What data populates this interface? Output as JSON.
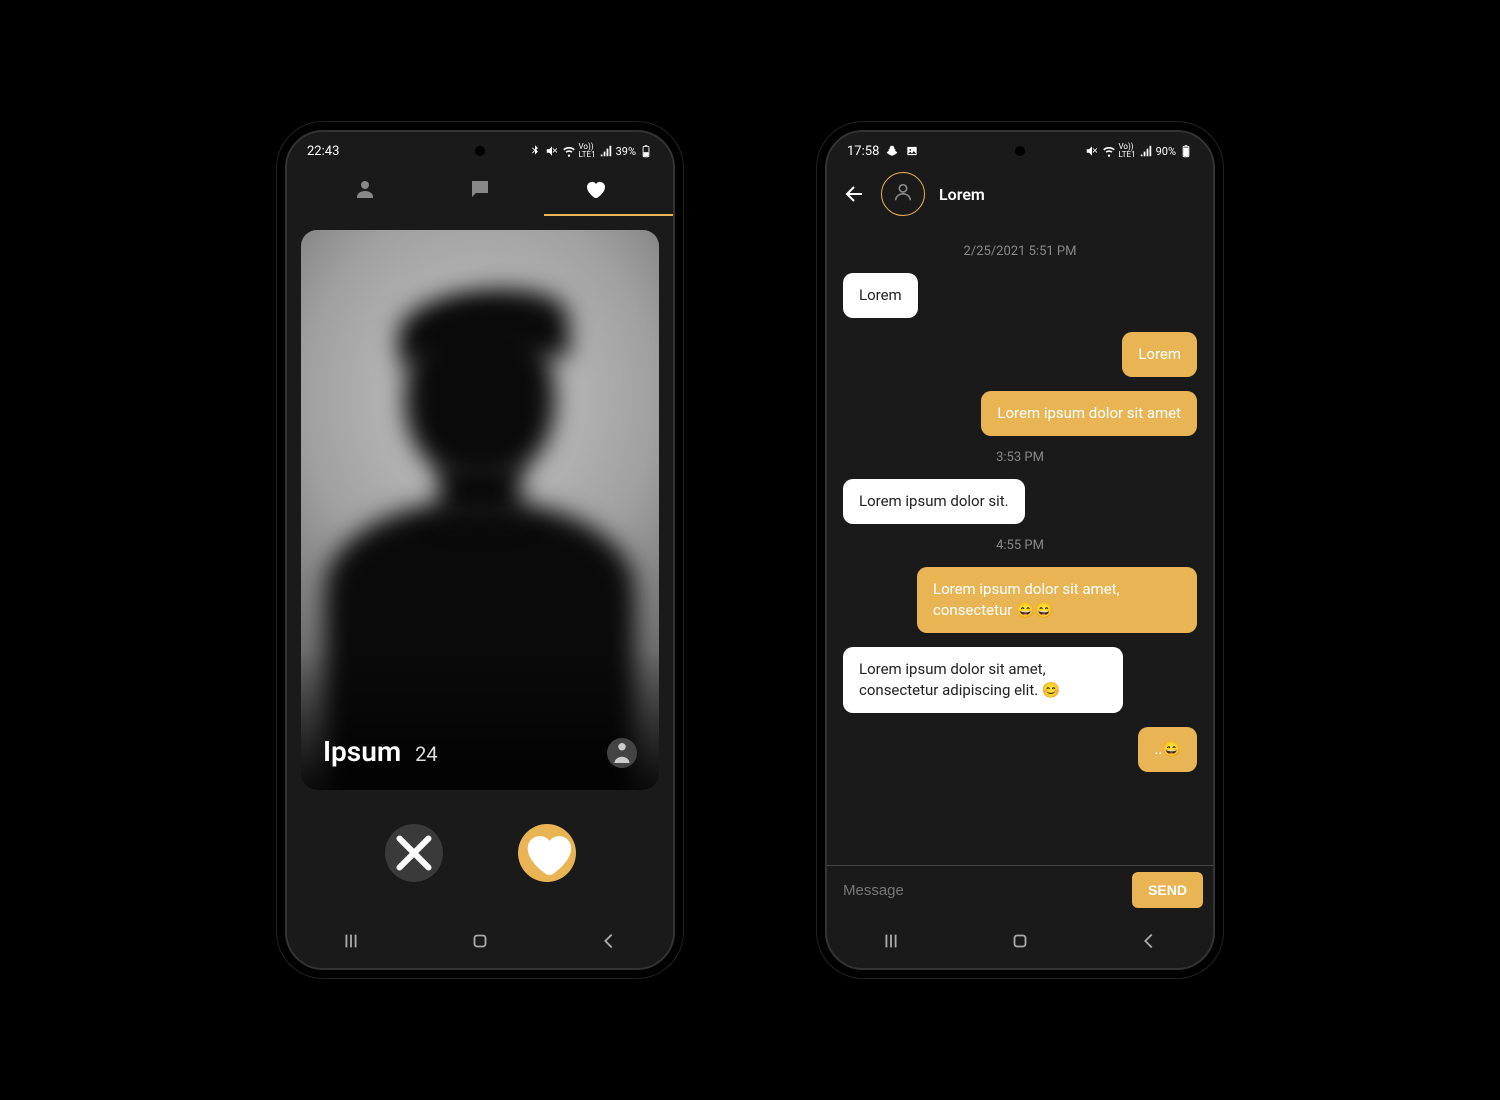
{
  "phone1": {
    "status": {
      "time": "22:43",
      "battery": "39%"
    },
    "card": {
      "name": "Ipsum",
      "age": "24"
    }
  },
  "phone2": {
    "status": {
      "time": "17:58",
      "battery": "90%"
    },
    "header": {
      "name": "Lorem"
    },
    "messages": {
      "ts1": "2/25/2021  5:51 PM",
      "m1": "Lorem",
      "m2": "Lorem",
      "m3": "Lorem ipsum dolor sit amet",
      "ts2": "3:53 PM",
      "m4": "Lorem ipsum dolor sit.",
      "ts3": "4:55 PM",
      "m5": "Lorem ipsum dolor sit amet, consectetur 😄😄",
      "m6": "Lorem ipsum dolor sit amet, consectetur adipiscing elit. 😊",
      "m7": "..😄"
    },
    "input": {
      "placeholder": "Message",
      "send": "SEND"
    }
  }
}
